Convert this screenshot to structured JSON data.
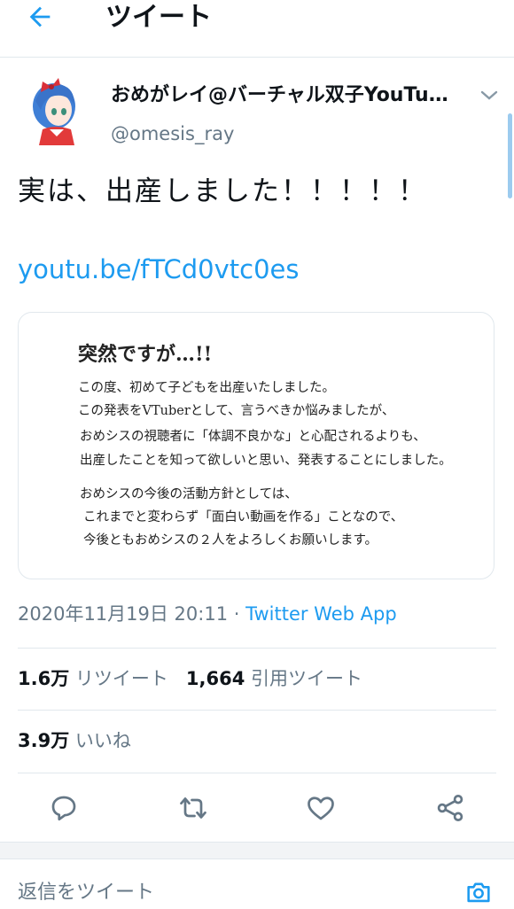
{
  "header": {
    "title": "ツイート",
    "back_icon": "back-arrow-icon"
  },
  "author": {
    "name": "おめがレイ@バーチャル双子YouTu…",
    "handle": "@omesis_ray"
  },
  "tweet": {
    "text": "実は、出産しました！！！！！",
    "link": "youtu.be/fTCd0vtc0es"
  },
  "card": {
    "heading": "突然ですが…!!",
    "lines": [
      "この度、初めて子どもを出産いたしました。",
      "この発表をVTuberとして、言うべきか悩みましたが、",
      "おめシスの視聴者に「体調不良かな」と心配されるよりも、",
      "出産したことを知って欲しいと思い、発表することにしました。",
      "おめシスの今後の活動方針としては、",
      "これまでと変わらず「面白い動画を作る」ことなので、",
      "今後ともおめシスの２人をよろしくお願いします。"
    ]
  },
  "meta": {
    "timestamp": "2020年11月19日 20:11",
    "separator": " · ",
    "app": "Twitter Web App"
  },
  "stats": {
    "retweets": "1.6万",
    "retweets_label": "リツイート",
    "quotes": "1,664",
    "quotes_label": "引用ツイート",
    "likes": "3.9万",
    "likes_label": "いいね"
  },
  "actions": [
    "reply-icon",
    "retweet-icon",
    "like-icon",
    "share-icon"
  ],
  "reply_box": {
    "placeholder": "返信をツイート",
    "camera_icon": "camera-icon"
  },
  "colors": {
    "accent": "#1d9bf0",
    "secondary_text": "#657786",
    "divider": "#e1e8ed"
  }
}
